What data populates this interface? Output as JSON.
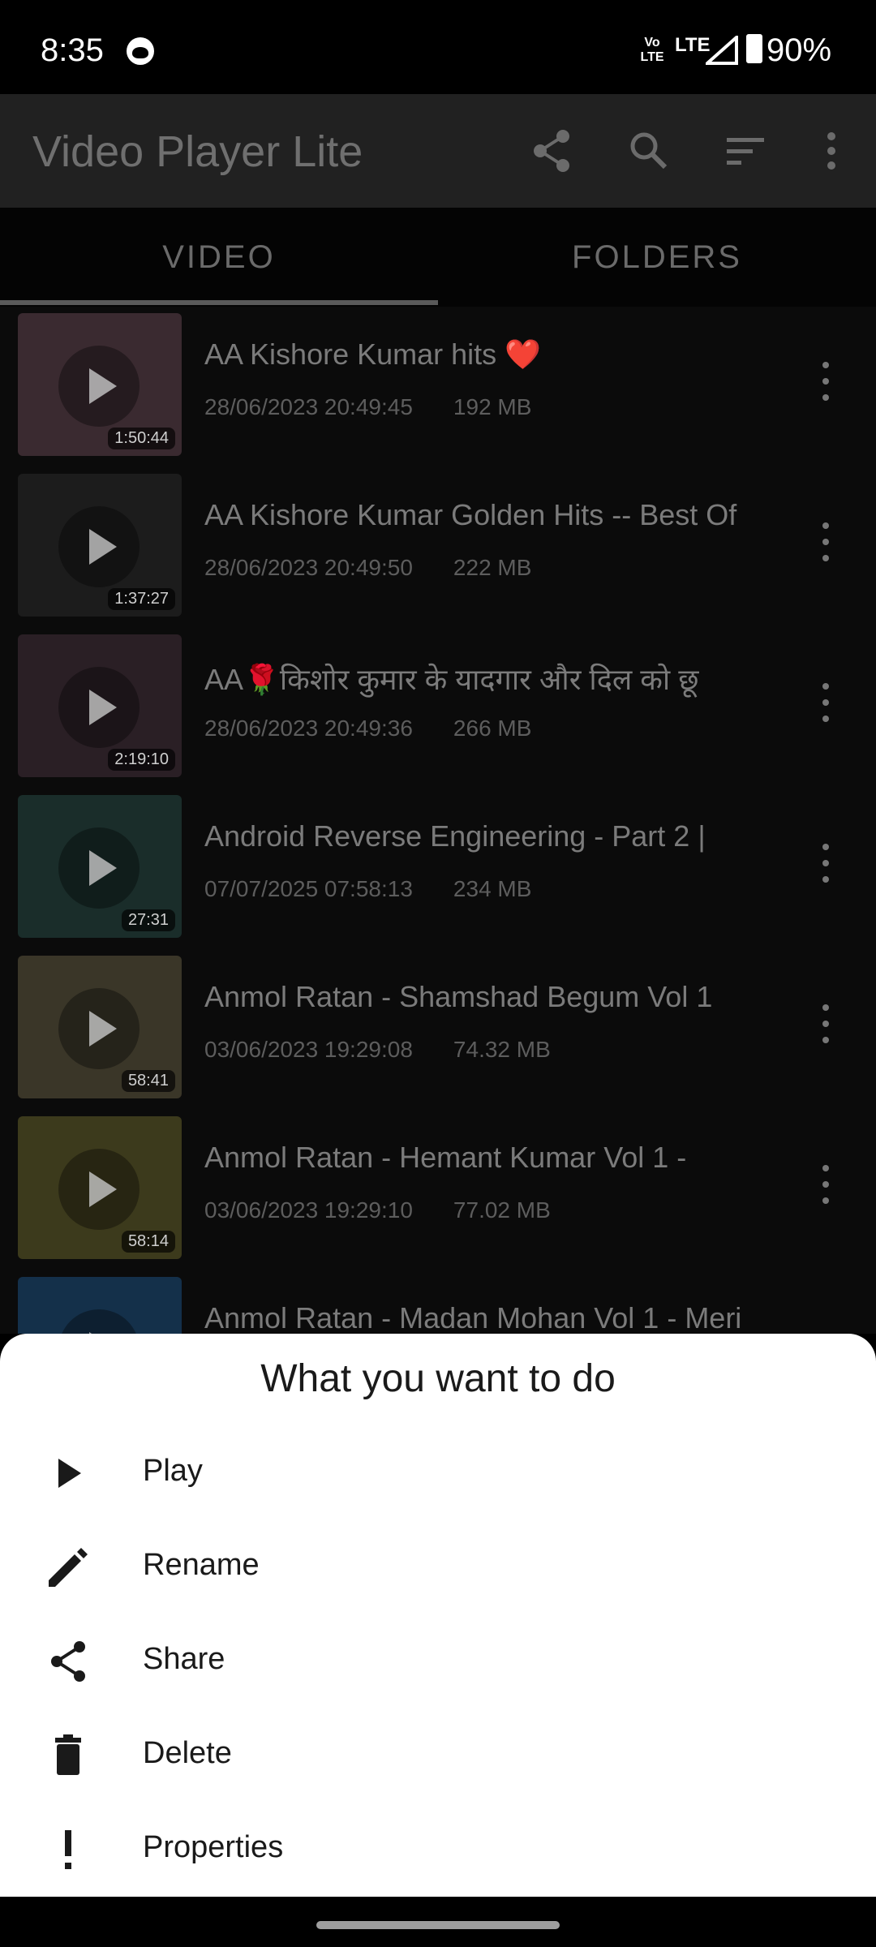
{
  "status_bar": {
    "time": "8:35",
    "volte": "Vo\nLTE",
    "network": "LTE",
    "battery": "90%"
  },
  "app_bar": {
    "title": "Video Player Lite",
    "icons": [
      "share-icon",
      "search-icon",
      "sort-icon",
      "more-vert-icon"
    ]
  },
  "tabs": [
    {
      "label": "VIDEO",
      "selected": true
    },
    {
      "label": "FOLDERS",
      "selected": false
    }
  ],
  "videos": [
    {
      "title": "AA  Kishore Kumar hits ",
      "emoji": "❤️",
      "date": "28/06/2023 20:49:45",
      "size": "192 MB",
      "duration": "1:50:44",
      "thumb_color": "#3a2a30"
    },
    {
      "title": "AA Kishore Kumar Golden Hits -- Best Of",
      "date": "28/06/2023 20:49:50",
      "size": "222 MB",
      "duration": "1:37:27",
      "thumb_color": "#1c1c1c"
    },
    {
      "title": "AA🌹किशोर कुमार के यादगार और दिल को छू",
      "date": "28/06/2023 20:49:36",
      "size": "266 MB",
      "duration": "2:19:10",
      "thumb_color": "#2a1f25"
    },
    {
      "title": "Android Reverse Engineering - Part 2  |",
      "date": "07/07/2025 07:58:13",
      "size": "234 MB",
      "duration": "27:31",
      "thumb_color": "#1a2d2a"
    },
    {
      "title": "Anmol Ratan  - Shamshad Begum Vol 1",
      "date": "03/06/2023 19:29:08",
      "size": "74.32 MB",
      "duration": "58:41",
      "thumb_color": "#3a3628"
    },
    {
      "title": "Anmol Ratan -  Hemant Kumar Vol 1 -",
      "date": "03/06/2023 19:29:10",
      "size": "77.02 MB",
      "duration": "58:14",
      "thumb_color": "#3c3a1c"
    },
    {
      "title": "Anmol Ratan -  Madan Mohan Vol 1 - Meri",
      "date": "",
      "size": "",
      "duration": "",
      "thumb_color": "#14304a"
    }
  ],
  "sheet": {
    "title": "What you want to do",
    "items": [
      {
        "label": "Play",
        "icon": "play-icon"
      },
      {
        "label": "Rename",
        "icon": "pencil-icon"
      },
      {
        "label": "Share",
        "icon": "share-icon"
      },
      {
        "label": "Delete",
        "icon": "trash-icon"
      },
      {
        "label": "Properties",
        "icon": "exclamation-icon"
      }
    ]
  },
  "colors": {
    "appbar_bg": "#212121",
    "sheet_bg": "#ffffff",
    "scrim_text": "#7b7b7b"
  }
}
